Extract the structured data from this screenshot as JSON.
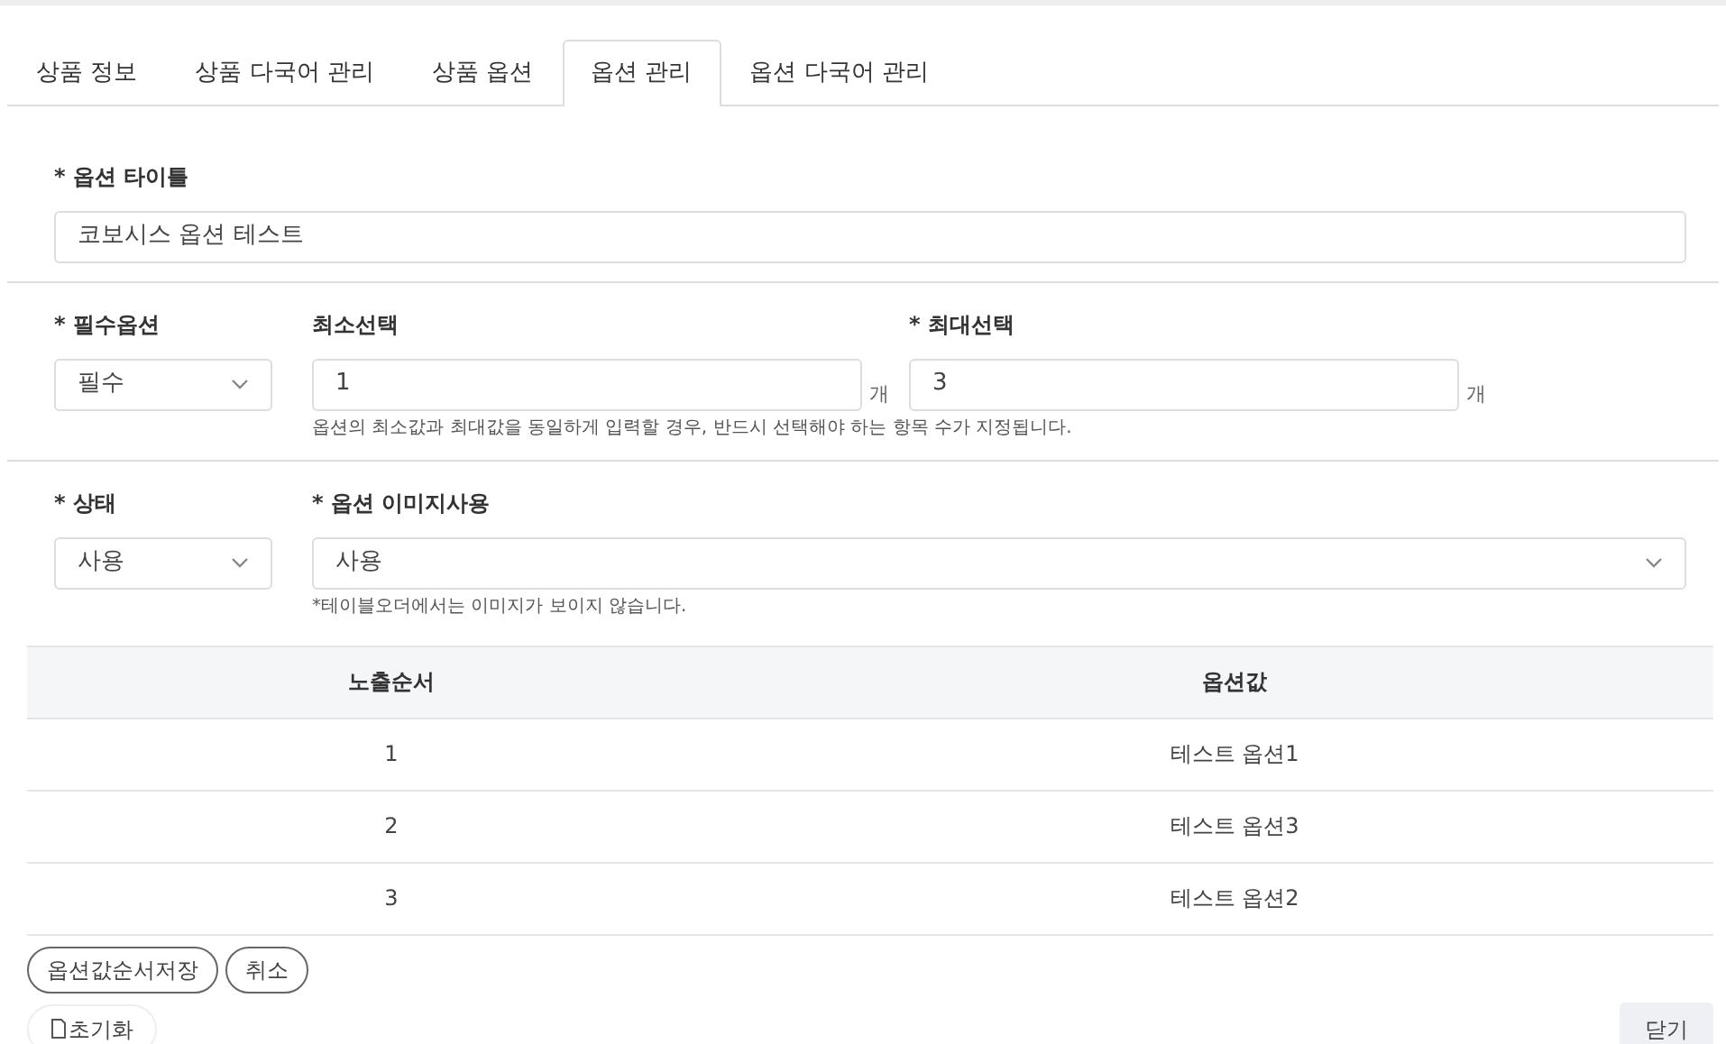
{
  "tabs": [
    {
      "label": "상품 정보",
      "selected": false
    },
    {
      "label": "상품 다국어 관리",
      "selected": false
    },
    {
      "label": "상품 옵션",
      "selected": false
    },
    {
      "label": "옵션 관리",
      "selected": true
    },
    {
      "label": "옵션 다국어 관리",
      "selected": false
    }
  ],
  "title_field": {
    "label": "* 옵션 타이틀",
    "value": "코보시스  옵션 테스트"
  },
  "required_select": {
    "label": "* 필수옵션",
    "value": "필수"
  },
  "min_select": {
    "label": "최소선택",
    "value": "1",
    "unit": "개"
  },
  "max_select": {
    "label": "* 최대선택",
    "value": "3",
    "unit": "개"
  },
  "select_help": "옵션의 최소값과 최대값을 동일하게 입력할 경우, 반드시 선택해야 하는 항목 수가 지정됩니다.",
  "status_select": {
    "label": "* 상태",
    "value": "사용"
  },
  "image_select": {
    "label": "* 옵션 이미지사용",
    "value": "사용"
  },
  "image_help": "*테이블오더에서는 이미지가 보이지 않습니다.",
  "table": {
    "columns": [
      "노출순서",
      "옵션값"
    ],
    "rows": [
      [
        "1",
        "테스트 옵션1"
      ],
      [
        "2",
        "테스트 옵션3"
      ],
      [
        "3",
        "테스트 옵션2"
      ]
    ]
  },
  "buttons": [
    "옵션값순서저장",
    "취소"
  ],
  "reset_button": "초기화",
  "close_button": "닫기"
}
